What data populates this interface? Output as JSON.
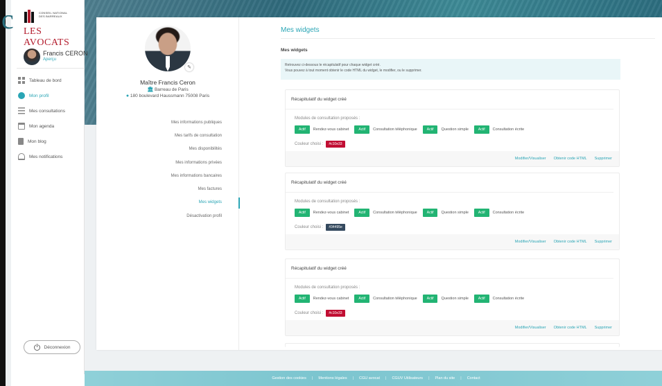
{
  "logo": {
    "line1": "CONSEIL NATIONAL",
    "line2": "DES BARREAUX",
    "main": "LES AVOCATS"
  },
  "overflow_char": "c",
  "user": {
    "name": "Francis CERON",
    "link": "Aperçu"
  },
  "nav": [
    {
      "label": "Tableau de bord",
      "icon": "dashboard-icon",
      "active": false
    },
    {
      "label": "Mon profil",
      "icon": "user-icon",
      "active": true
    },
    {
      "label": "Mes consultations",
      "icon": "list-icon",
      "active": false
    },
    {
      "label": "Mon agenda",
      "icon": "calendar-icon",
      "active": false
    },
    {
      "label": "Mon blog",
      "icon": "document-icon",
      "active": false
    },
    {
      "label": "Mes notifications",
      "icon": "bell-icon",
      "active": false
    }
  ],
  "logout": "Déconnexion",
  "profile_card": {
    "title": "Maître Francis Ceron",
    "barreau": "Barreau de Paris",
    "address": "180 boulevard Haussmann 75008 Paris"
  },
  "profile_menu": [
    "Mes informations publiques",
    "Mes tarifs de consultation",
    "Mes disponibilités",
    "Mes informations privées",
    "Mes informations bancaires",
    "Mes factures",
    "Mes widgets",
    "Désactivation profil"
  ],
  "profile_menu_active": "Mes widgets",
  "main": {
    "title": "Mes widgets",
    "subtitle": "Mes widgets",
    "info_line1": "Retrouvez ci-dessous le récapitulatif pour chaque widget créé.",
    "info_line2": "Vous pouvez à tout moment obtenir le code HTML du widget, le modifier, ou le supprimer."
  },
  "widgets": [
    {
      "title": "Récapitulatif du widget créé",
      "modules_label": "Modules de consultation proposés :",
      "modules": [
        "Rendez-vous cabinet",
        "Consultation téléphonique",
        "Question simple",
        "Consultation écrite"
      ],
      "badge": "Actif",
      "color_label": "Couleur choisi :",
      "color": "#c10e33",
      "actions": [
        "Modifier/Visualiser",
        "Obtenir code HTML",
        "Supprimer"
      ]
    },
    {
      "title": "Récapitulatif du widget créé",
      "modules_label": "Modules de consultation proposés :",
      "modules": [
        "Rendez-vous cabinet",
        "Consultation téléphonique",
        "Question simple",
        "Consultation écrite"
      ],
      "badge": "Actif",
      "color_label": "Couleur choisi :",
      "color": "#34495e",
      "actions": [
        "Modifier/Visualiser",
        "Obtenir code HTML",
        "Supprimer"
      ]
    },
    {
      "title": "Récapitulatif du widget créé",
      "modules_label": "Modules de consultation proposés :",
      "modules": [
        "Rendez-vous cabinet",
        "Consultation téléphonique",
        "Question simple",
        "Consultation écrite"
      ],
      "badge": "Actif",
      "color_label": "Couleur choisi :",
      "color": "#c10e33",
      "actions": [
        "Modifier/Visualiser",
        "Obtenir code HTML",
        "Supprimer"
      ]
    }
  ],
  "footer": [
    "Gestion des cookies",
    "Mentions légales",
    "CGU avocat",
    "CGUV Utilisateurs",
    "Plan du site",
    "Contact"
  ],
  "colors": {
    "accent": "#2aa5b5",
    "active_badge": "#22b473",
    "brand_red": "#b31b2c"
  }
}
